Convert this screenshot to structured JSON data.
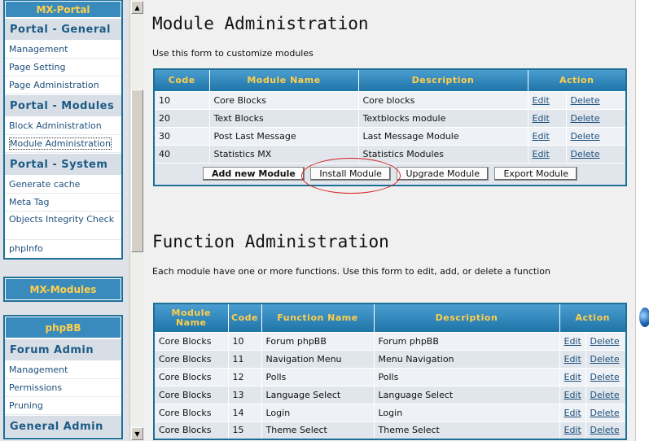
{
  "sidebar": {
    "mxportal": {
      "title": "MX-Portal",
      "sections": [
        {
          "heading": "Portal - General",
          "links": [
            "Management",
            "Page Setting",
            "Page Administration"
          ]
        },
        {
          "heading": "Portal - Modules",
          "links": [
            "Block Administration",
            "Module Administration"
          ]
        },
        {
          "heading": "Portal - System",
          "links": [
            "Generate cache",
            "Meta Tag",
            "Objects Integrity Check",
            "phpInfo"
          ]
        }
      ]
    },
    "mxmodules": {
      "title": "MX-Modules"
    },
    "phpbb": {
      "title": "phpBB",
      "sections": [
        {
          "heading": "Forum Admin",
          "links": [
            "Management",
            "Permissions",
            "Pruning"
          ]
        },
        {
          "heading": "General Admin",
          "links": []
        }
      ]
    }
  },
  "module_admin": {
    "title": "Module Administration",
    "intro": "Use this form to customize modules",
    "headers": [
      "Code",
      "Module Name",
      "Description",
      "Action"
    ],
    "rows": [
      {
        "code": "10",
        "name": "Core Blocks",
        "desc": "Core blocks",
        "edit": "Edit",
        "delete": "Delete"
      },
      {
        "code": "20",
        "name": "Text Blocks",
        "desc": "Textblocks module",
        "edit": "Edit",
        "delete": "Delete"
      },
      {
        "code": "30",
        "name": "Post Last Message",
        "desc": "Last Message Module",
        "edit": "Edit",
        "delete": "Delete"
      },
      {
        "code": "40",
        "name": "Statistics MX",
        "desc": "Statistics Modules",
        "edit": "Edit",
        "delete": "Delete"
      }
    ],
    "buttons": {
      "add": "Add new Module",
      "install": "Install Module",
      "upgrade": "Upgrade Module",
      "export": "Export Module"
    }
  },
  "function_admin": {
    "title": "Function Administration",
    "intro": "Each module have one or more functions. Use this form to edit, add, or delete a function",
    "headers": [
      "Module Name",
      "Code",
      "Function Name",
      "Description",
      "Action"
    ],
    "rows": [
      {
        "module": "Core Blocks",
        "code": "10",
        "name": "Forum phpBB",
        "desc": "Forum phpBB",
        "edit": "Edit",
        "delete": "Delete"
      },
      {
        "module": "Core Blocks",
        "code": "11",
        "name": "Navigation Menu",
        "desc": "Menu Navigation",
        "edit": "Edit",
        "delete": "Delete"
      },
      {
        "module": "Core Blocks",
        "code": "12",
        "name": "Polls",
        "desc": "Polls",
        "edit": "Edit",
        "delete": "Delete"
      },
      {
        "module": "Core Blocks",
        "code": "13",
        "name": "Language Select",
        "desc": "Language Select",
        "edit": "Edit",
        "delete": "Delete"
      },
      {
        "module": "Core Blocks",
        "code": "14",
        "name": "Login",
        "desc": "Login",
        "edit": "Edit",
        "delete": "Delete"
      },
      {
        "module": "Core Blocks",
        "code": "15",
        "name": "Theme Select",
        "desc": "Theme Select",
        "edit": "Edit",
        "delete": "Delete"
      }
    ]
  },
  "colors": {
    "accent": "#1d6f98",
    "header_text": "#ffcf4a",
    "annotation": "#d42020"
  },
  "icons": {
    "scroll_up": "arrow-up-icon",
    "scroll_down": "arrow-down-icon",
    "globe": "globe-icon"
  }
}
